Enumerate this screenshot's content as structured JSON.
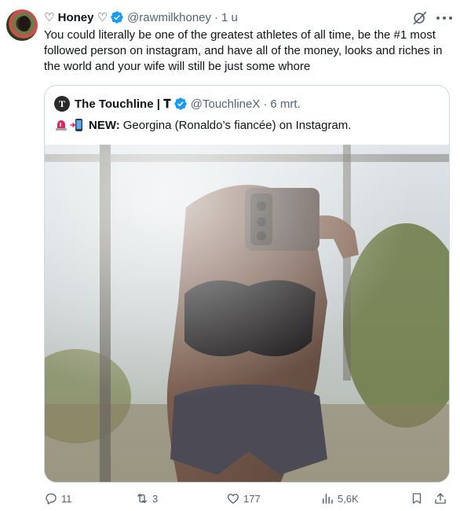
{
  "author": {
    "display_name": "♡ Honey ♡",
    "handle": "@rawmilkhoney",
    "separator": "·",
    "time": "1 u"
  },
  "tweet": {
    "text": "You could literally be one of the greatest athletes of all time, be the #1 most followed person on instagram, and have all of the money, looks and riches in the world and your wife will still be just some whore"
  },
  "quote": {
    "avatar_letter": "T",
    "display_name": "The Touchline | 𝐓",
    "handle": "@TouchlineX",
    "separator": "·",
    "time": "6 mrt.",
    "new_label": "NEW:",
    "text": "Georgina (Ronaldo’s fiancée) on Instagram."
  },
  "actions": {
    "replies": "11",
    "reposts": "3",
    "likes": "177",
    "views": "5,6K"
  },
  "colors": {
    "verified": "#1d9bf0",
    "secondary_text": "#536471",
    "border": "#cfd9de",
    "primary_text": "#0f1419"
  },
  "icons": {
    "verified": "verified-badge-icon",
    "grok": "grok-icon",
    "more": "more-icon",
    "reply": "reply-icon",
    "repost": "repost-icon",
    "like": "like-icon",
    "views": "views-icon",
    "bookmark": "bookmark-icon",
    "share": "share-icon",
    "siren": "siren-emoji-icon",
    "phone": "mobile-phone-emoji-icon"
  }
}
